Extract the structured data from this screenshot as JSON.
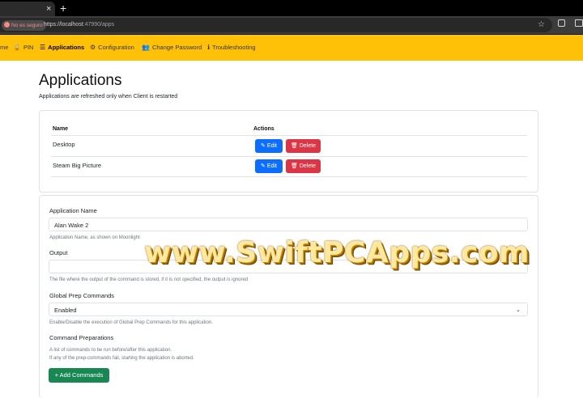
{
  "browser": {
    "tab_close": "×",
    "new_tab": "+",
    "security_label": "No es seguro",
    "url_host": "https://localhost",
    "url_rest": ":47990/apps",
    "star": "☆"
  },
  "nav": {
    "items": [
      {
        "label": "me",
        "icon": ""
      },
      {
        "label": "PIN",
        "icon": "🔒"
      },
      {
        "label": "Applications",
        "icon": "☰"
      },
      {
        "label": "Configuration",
        "icon": "⚙"
      },
      {
        "label": "Change Password",
        "icon": "👥"
      },
      {
        "label": "Troubleshooting",
        "icon": "ℹ"
      }
    ],
    "accent": "#ffc107"
  },
  "page": {
    "title": "Applications",
    "subtitle": "Applications are refreshed only when Client is restarted"
  },
  "apps_table": {
    "headers": {
      "name": "Name",
      "actions": "Actions"
    },
    "rows": [
      {
        "name": "Desktop"
      },
      {
        "name": "Steam Big Picture"
      }
    ],
    "edit_label": "Edit",
    "delete_label": "Delete"
  },
  "form": {
    "app_name": {
      "label": "Application Name",
      "value": "Alan Wake 2",
      "help": "Application Name, as shown on Moonlight"
    },
    "output": {
      "label": "Output",
      "value": "",
      "help": "The file where the output of the command is stored, if it is not specified, the output is ignored"
    },
    "global_prep": {
      "label": "Global Prep Commands",
      "value": "Enabled",
      "help": "Enable/Disable the execution of Global Prep Commands for this application."
    },
    "command_prep": {
      "label": "Command Preparations",
      "help1": "A list of commands to be run before/after this application.",
      "help2": "If any of the prep-commands fail, starting the application is aborted.",
      "add_label": "+ Add Commands"
    }
  },
  "watermark": "www.SwiftPCApps.com"
}
